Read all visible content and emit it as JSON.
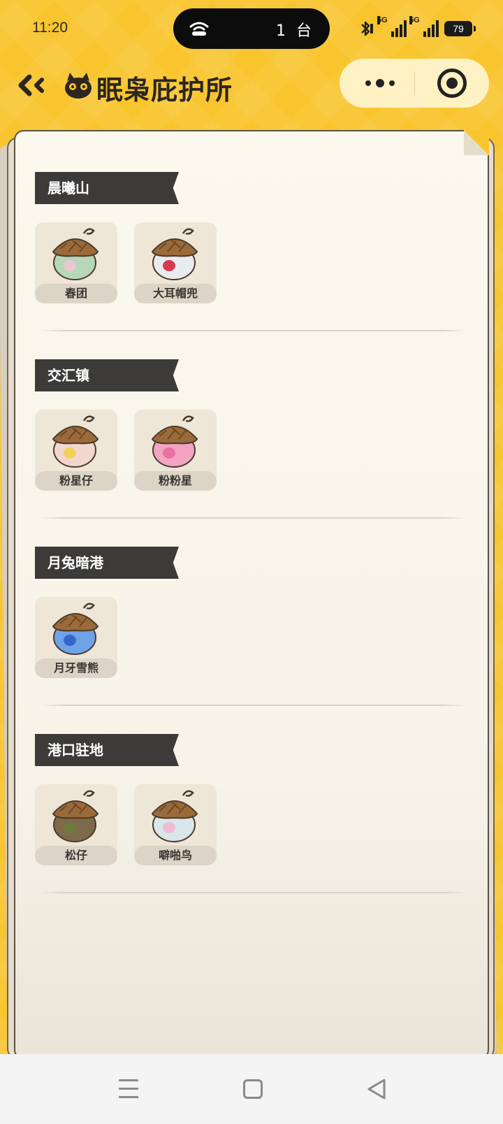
{
  "status_bar": {
    "time": "11:20",
    "island_text": "1 台",
    "network_1": "5G",
    "network_2": "5G",
    "battery": "79"
  },
  "header": {
    "title": "眠枭庇护所"
  },
  "sections": [
    {
      "name": "晨曦山",
      "items": [
        {
          "label": "春团",
          "color": "#b7d7b9",
          "accent": "#f0c6d0"
        },
        {
          "label": "大耳帽兜",
          "color": "#e9ecef",
          "accent": "#d7263d"
        }
      ]
    },
    {
      "name": "交汇镇",
      "items": [
        {
          "label": "粉星仔",
          "color": "#f3d6cf",
          "accent": "#f4d14d"
        },
        {
          "label": "粉粉星",
          "color": "#f2a4c2",
          "accent": "#ea6aa0"
        }
      ]
    },
    {
      "name": "月兔暗港",
      "items": [
        {
          "label": "月牙雪熊",
          "color": "#6fa3e8",
          "accent": "#2f5fc4"
        }
      ]
    },
    {
      "name": "港口驻地",
      "items": [
        {
          "label": "松仔",
          "color": "#7d6a4a",
          "accent": "#6b7d3a"
        },
        {
          "label": "噼啪鸟",
          "color": "#d9e6ea",
          "accent": "#f1b6cf"
        }
      ]
    }
  ],
  "colors": {
    "background": "#f9c52e",
    "paper": "#fbf8ee",
    "tag": "#3c3b3a",
    "acorn_cap": "#9a6a3a"
  }
}
